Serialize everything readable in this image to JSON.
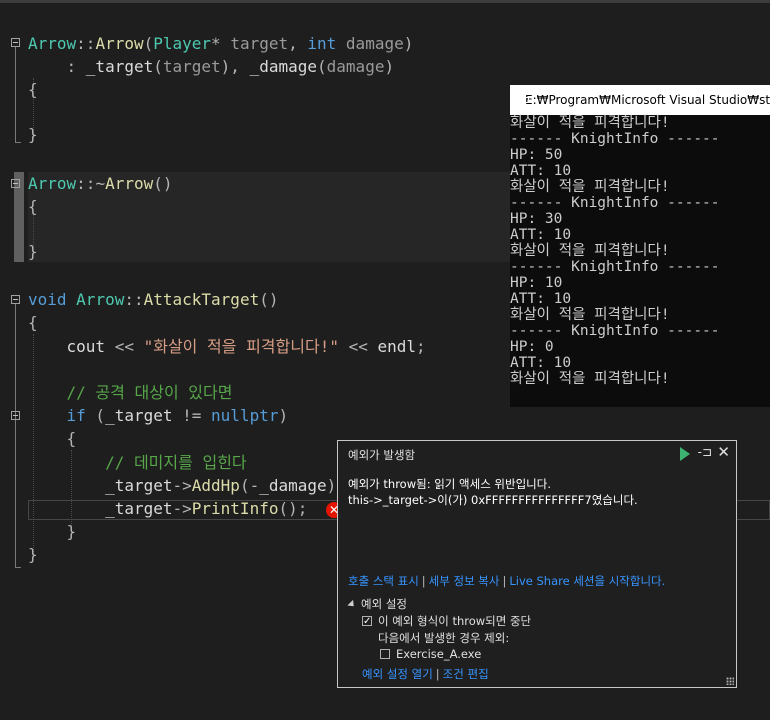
{
  "editor": {
    "lines": [
      {
        "id": "ctor-sig",
        "parts": [
          [
            "ty",
            "Arrow"
          ],
          [
            "op",
            "::"
          ],
          [
            "fn",
            "Arrow"
          ],
          [
            "op",
            "("
          ],
          [
            "ty",
            "Player"
          ],
          [
            "op",
            "* "
          ],
          [
            "pm",
            "target"
          ],
          [
            "op",
            ", "
          ],
          [
            "kw",
            "int"
          ],
          [
            "op",
            " "
          ],
          [
            "pm",
            "damage"
          ],
          [
            "op",
            ")"
          ]
        ]
      },
      {
        "id": "ctor-init",
        "parts": [
          [
            "op",
            "    : "
          ],
          [
            "mb",
            "_target"
          ],
          [
            "op",
            "("
          ],
          [
            "pm",
            "target"
          ],
          [
            "op",
            "), "
          ],
          [
            "mb",
            "_damage"
          ],
          [
            "op",
            "("
          ],
          [
            "pm",
            "damage"
          ],
          [
            "op",
            ")"
          ]
        ]
      },
      {
        "id": "ctor-open",
        "parts": [
          [
            "op",
            "{"
          ]
        ]
      },
      {
        "id": "ctor-close",
        "parts": [
          [
            "op",
            "}"
          ]
        ]
      },
      {
        "id": "dtor-sig",
        "parts": [
          [
            "ty",
            "Arrow"
          ],
          [
            "op",
            "::~"
          ],
          [
            "fn",
            "Arrow"
          ],
          [
            "op",
            "()"
          ]
        ]
      },
      {
        "id": "dtor-open",
        "parts": [
          [
            "op",
            "{"
          ]
        ]
      },
      {
        "id": "dtor-close",
        "parts": [
          [
            "op",
            "}"
          ]
        ]
      },
      {
        "id": "attack-sig",
        "parts": [
          [
            "kw",
            "void"
          ],
          [
            "op",
            " "
          ],
          [
            "ty",
            "Arrow"
          ],
          [
            "op",
            "::"
          ],
          [
            "fn",
            "AttackTarget"
          ],
          [
            "op",
            "()"
          ]
        ]
      },
      {
        "id": "attack-open",
        "parts": [
          [
            "op",
            "{"
          ]
        ]
      },
      {
        "id": "cout-line",
        "parts": [
          [
            "op",
            "    "
          ],
          [
            "mb",
            "cout"
          ],
          [
            "op",
            " << "
          ],
          [
            "str",
            "\"화살이 적을 피격합니다!\""
          ],
          [
            "op",
            " << "
          ],
          [
            "mb",
            "endl"
          ],
          [
            "op",
            ";"
          ]
        ]
      },
      {
        "id": "comment-1",
        "parts": [
          [
            "cm",
            "    // 공격 대상이 있다면"
          ]
        ]
      },
      {
        "id": "if-line",
        "parts": [
          [
            "op",
            "    "
          ],
          [
            "kw",
            "if"
          ],
          [
            "op",
            " ("
          ],
          [
            "mb",
            "_target"
          ],
          [
            "op",
            " != "
          ],
          [
            "kw",
            "nullptr"
          ],
          [
            "op",
            ")"
          ]
        ]
      },
      {
        "id": "if-open",
        "parts": [
          [
            "op",
            "    {"
          ]
        ]
      },
      {
        "id": "comment-2",
        "parts": [
          [
            "cm",
            "        // 데미지를 입힌다"
          ]
        ]
      },
      {
        "id": "addhp-line",
        "parts": [
          [
            "op",
            "        "
          ],
          [
            "mb",
            "_target"
          ],
          [
            "op",
            "->"
          ],
          [
            "fn",
            "AddHp"
          ],
          [
            "op",
            "(-"
          ],
          [
            "mb",
            "_damage"
          ],
          [
            "op",
            ");"
          ]
        ]
      },
      {
        "id": "printinfo-line",
        "parts": [
          [
            "op",
            "        "
          ],
          [
            "mb",
            "_target"
          ],
          [
            "op",
            "->"
          ],
          [
            "fn",
            "PrintInfo"
          ],
          [
            "op",
            "();"
          ]
        ]
      },
      {
        "id": "if-close",
        "parts": [
          [
            "op",
            "    }"
          ]
        ]
      },
      {
        "id": "attack-close",
        "parts": [
          [
            "op",
            "}"
          ]
        ]
      }
    ]
  },
  "console": {
    "title": "E:₩Program₩Microsoft Visual Studio₩studi",
    "output": [
      "화살이 적을 피격합니다!",
      "------ KnightInfo ------",
      "HP: 50",
      "ATT: 10",
      "화살이 적을 피격합니다!",
      "------ KnightInfo ------",
      "HP: 30",
      "ATT: 10",
      "화살이 적을 피격합니다!",
      "------ KnightInfo ------",
      "HP: 10",
      "ATT: 10",
      "화살이 적을 피격합니다!",
      "------ KnightInfo ------",
      "HP: 0",
      "ATT: 10",
      "화살이 적을 피격합니다!"
    ]
  },
  "exception": {
    "header": "예외가 발생함",
    "pin_glyph": "-⊐",
    "close_glyph": "✕",
    "message_line1": "예외가 throw됨: 읽기 액세스 위반입니다.",
    "message_line2": "this->_target->이(가) 0xFFFFFFFFFFFFFFF7였습니다.",
    "link_call_stack": "호출 스택 표시",
    "link_copy_details": "세부 정보 복사",
    "link_live_share": "Live Share 세션을 시작합니다.",
    "separator": "|",
    "settings_title": "예외 설정",
    "break_when_thrown": "이 예외 형식이 throw되면 중단",
    "except_when_from": "다음에서 발생한 경우 제외:",
    "module_name": "Exercise_A.exe",
    "link_open_settings": "예외 설정 열기",
    "link_edit_conditions": "조건 편집",
    "check_mark": "✓",
    "error_glyph": "✕",
    "colors": {
      "link": "#3794ff",
      "play": "#3cb371",
      "error": "#e51400"
    }
  }
}
